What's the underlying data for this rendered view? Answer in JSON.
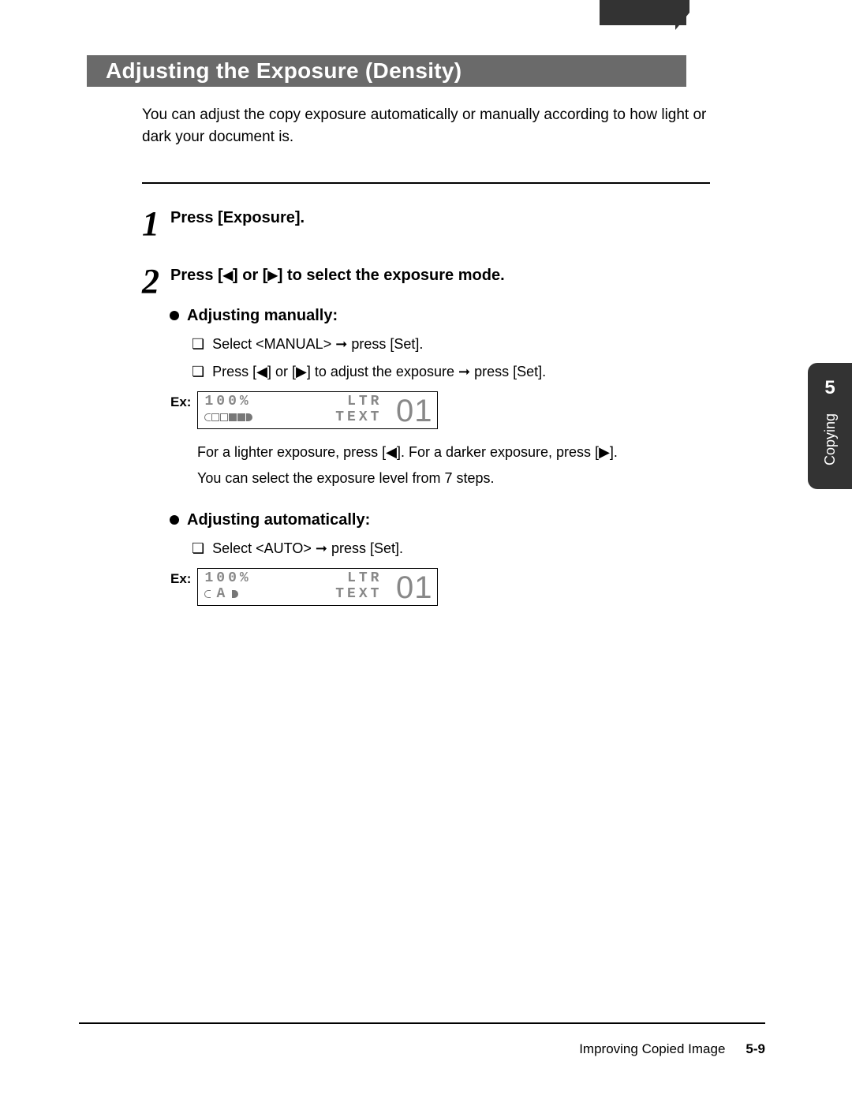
{
  "banner": {
    "title": "Adjusting the Exposure (Density)"
  },
  "intro": "You can adjust the copy exposure automatically or manually according to how light or dark your document is.",
  "steps": [
    {
      "num": "1",
      "title": "Press [Exposure]."
    },
    {
      "num": "2",
      "title_pre": "Press [",
      "title_mid": "] or [",
      "title_post": "] to select the exposure mode."
    }
  ],
  "manual": {
    "heading": "Adjusting manually:",
    "line1_pre": "Select <MANUAL> ",
    "line1_post": " press [Set].",
    "line2_pre": "Press [",
    "line2_mid": "] or [",
    "line2_mid2": "] to adjust the exposure ",
    "line2_post": " press [Set].",
    "lcd_label": "Ex:",
    "lcd": {
      "zoom": "100%",
      "paper": "LTR",
      "mode": "TEXT",
      "copies": "01"
    },
    "tip1_pre": "For a lighter exposure, press [",
    "tip1_mid": "]. For a darker exposure, press [",
    "tip1_post": "].",
    "tip2": "You can select the exposure level from 7 steps."
  },
  "auto": {
    "heading": "Adjusting automatically:",
    "line1_pre": "Select <AUTO> ",
    "line1_post": " press [Set].",
    "lcd_label": "Ex:",
    "lcd": {
      "zoom": "100%",
      "paper": "LTR",
      "auto_label": "A",
      "mode": "TEXT",
      "copies": "01"
    }
  },
  "sidetab": {
    "num": "5",
    "label": "Copying"
  },
  "footer": {
    "section": "Improving Copied Image",
    "page": "5-9"
  },
  "glyphs": {
    "left": "◀",
    "right": "▶",
    "arrow": "➞",
    "box": "❏"
  }
}
